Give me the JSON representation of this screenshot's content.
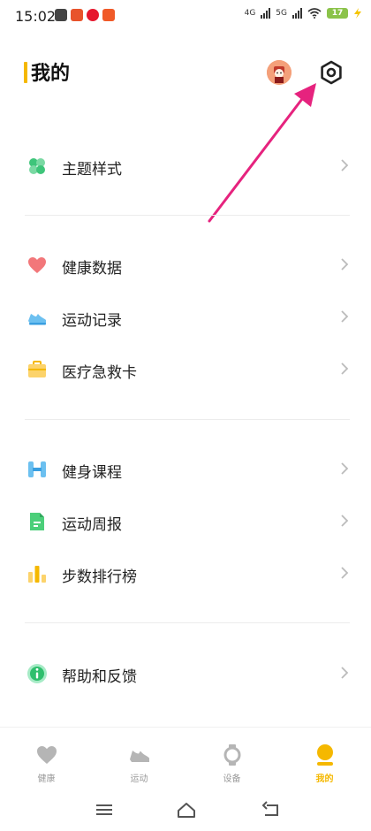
{
  "status_bar": {
    "time": "15:02",
    "network_1": "4G",
    "network_2": "5G",
    "battery": "17",
    "colors": {
      "battery": "#8bc34a"
    }
  },
  "header": {
    "title": "我的",
    "accent_color": "#f5b800"
  },
  "menu": {
    "group1": [
      {
        "label": "主题样式",
        "icon": "clover-icon"
      }
    ],
    "group2": [
      {
        "label": "健康数据",
        "icon": "heart-icon"
      },
      {
        "label": "运动记录",
        "icon": "sneaker-icon"
      },
      {
        "label": "医疗急救卡",
        "icon": "medical-kit-icon"
      }
    ],
    "group3": [
      {
        "label": "健身课程",
        "icon": "dumbbell-icon"
      },
      {
        "label": "运动周报",
        "icon": "report-document-icon"
      },
      {
        "label": "步数排行榜",
        "icon": "ranking-bars-icon"
      }
    ],
    "group4": [
      {
        "label": "帮助和反馈",
        "icon": "info-icon"
      }
    ]
  },
  "tabs": [
    {
      "label": "健康",
      "icon": "heart-icon",
      "active": false
    },
    {
      "label": "运动",
      "icon": "sneaker-icon",
      "active": false
    },
    {
      "label": "设备",
      "icon": "watch-icon",
      "active": false
    },
    {
      "label": "我的",
      "icon": "profile-icon",
      "active": true
    }
  ],
  "colors": {
    "active_tab": "#f5b800",
    "inactive_tab": "#bbbbbb",
    "annotation_arrow": "#e6237e"
  }
}
